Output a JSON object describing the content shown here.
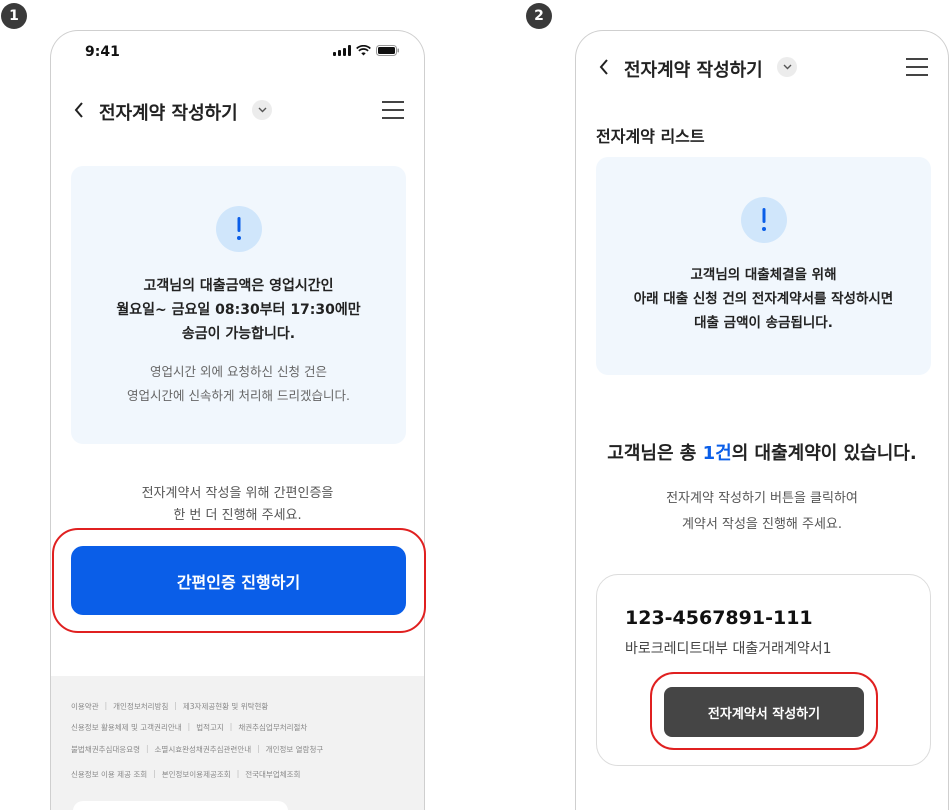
{
  "badges": {
    "step1": "1",
    "step2": "2"
  },
  "screen1": {
    "status_time": "9:41",
    "title": "전자계약 작성하기",
    "icons": {
      "back": "back-arrow-icon",
      "dropdown": "chevron-down-icon",
      "menu": "hamburger-menu-icon",
      "alert": "exclamation-icon"
    },
    "notice_line1": "고객님의 대출금액은 영업시간인",
    "notice_line2": "월요일~ 금요일 08:30부터 17:30에만",
    "notice_line3": "송금이 가능합니다.",
    "sub_line1": "영업시간 외에 요청하신 신청 건은",
    "sub_line2": "영업시간에 신속하게 처리해 드리겠습니다.",
    "instruction_line1": "전자계약서 작성을 위해 간편인증을",
    "instruction_line2": "한 번 더 진행해 주세요.",
    "primary_button": "간편인증 진행하기",
    "footer_rows": [
      [
        "이용약관",
        "개인정보처리방침",
        "제3자제공현황 및 위탁현황"
      ],
      [
        "신용정보 활용체제 및 고객권리안내",
        "법적고지",
        "채권추심업무처리절차"
      ],
      [
        "불법채권추심대응요령",
        "소멸시효완성채권추심관련안내",
        "개인정보 열람청구"
      ],
      [
        "신용정보 이용 제공 조회",
        "본인정보이용제공조회",
        "전국대부업체조회"
      ]
    ]
  },
  "screen2": {
    "title": "전자계약 작성하기",
    "section_title": "전자계약 리스트",
    "notice_line1": "고객님의 대출체결을 위해",
    "notice_line2": "아래 대출 신청 건의 전자계약서를 작성하시면",
    "notice_line3": "대출 금액이 송금됩니다.",
    "summary_prefix": "고객님은 총 ",
    "summary_count": "1건",
    "summary_suffix": "의 대출계약이 있습니다.",
    "guide_line1": "전자계약 작성하기 버튼을 클릭하여",
    "guide_line2": "계약서 작성을 진행해 주세요.",
    "contract_number": "123-4567891-111",
    "contract_name": "바로크레디트대부 대출거래계약서1",
    "write_button": "전자계약서 작성하기"
  },
  "colors": {
    "accent": "#0a5ee8",
    "highlight": "#e02020",
    "card_bg": "#f1f7fd",
    "dark_button": "#454545"
  }
}
